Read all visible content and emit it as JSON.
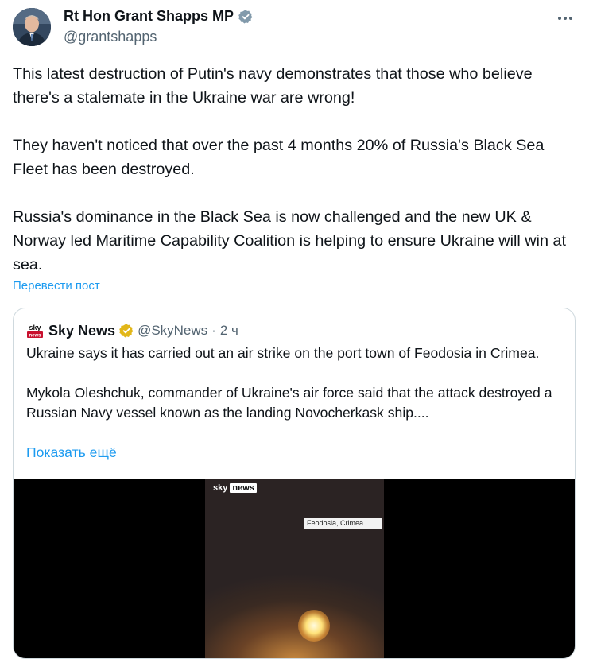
{
  "author": {
    "display_name": "Rt Hon Grant Shapps MP",
    "handle": "@grantshapps",
    "avatar_icon": "avatar-portrait-icon",
    "verified_icon": "verified-grey-badge-icon"
  },
  "more_icon": "more-horizontal-icon",
  "tweet": {
    "paragraphs": [
      "This latest destruction of Putin's navy demonstrates that those who believe there's a stalemate in the Ukraine war are wrong!",
      "They haven't noticed that over the past 4 months 20% of Russia's Black Sea Fleet has been destroyed.",
      "Russia's dominance in the Black Sea is now challenged and the new UK & Norway led Maritime Capability Coalition is helping to ensure Ukraine will win at sea."
    ],
    "translate_label": "Перевести пост"
  },
  "quote": {
    "logo_text": "sky news",
    "name": "Sky News",
    "verified_icon": "verified-gold-badge-icon",
    "handle": "@SkyNews",
    "separator": "·",
    "time": "2 ч",
    "paragraphs": [
      "Ukraine says it has carried out an air strike on the port town of Feodosia in Crimea.",
      "Mykola Oleshchuk, commander of Ukraine's air force said that the attack destroyed a Russian Navy vessel known as the landing Novocherkask ship...."
    ],
    "show_more_label": "Показать ещё",
    "media": {
      "watermark_sky": "sky",
      "watermark_news": "news",
      "location_label": "Feodosia, Crimea"
    }
  },
  "colors": {
    "text": "#0f1419",
    "secondary": "#536471",
    "link": "#1d9bf0",
    "border": "#cfd9de",
    "gold_badge": "#e2b719",
    "grey_badge": "#829aab"
  }
}
